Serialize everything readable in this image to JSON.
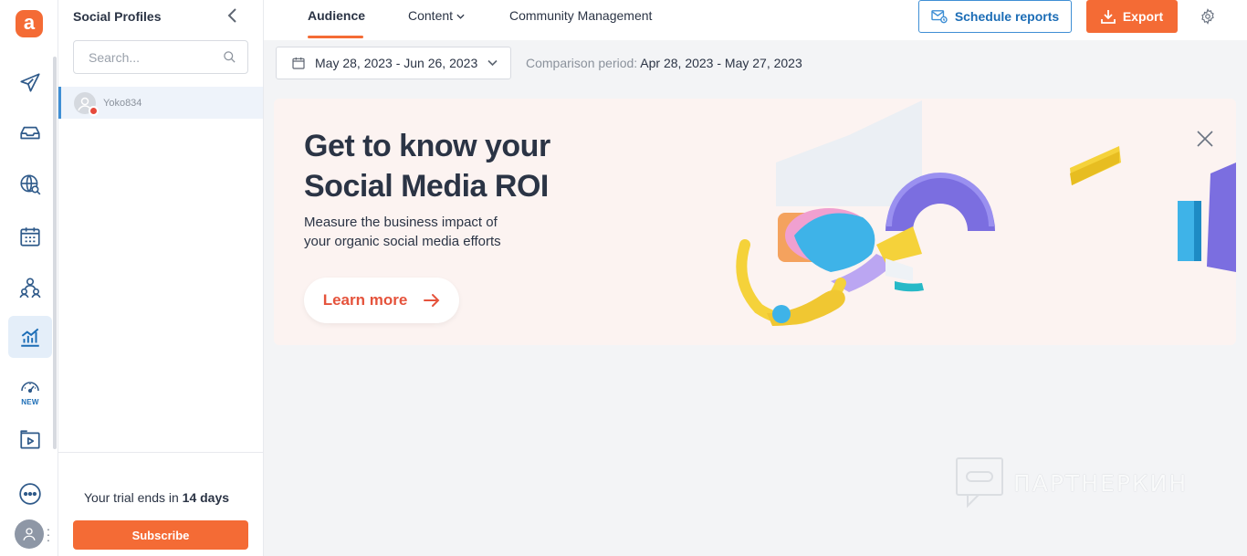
{
  "brand": {
    "logo_letter": "a",
    "accent": "#f46b35",
    "active_blue": "#1c6db6"
  },
  "rail": {
    "items": [
      {
        "name": "publish",
        "icon": "paper-plane-icon"
      },
      {
        "name": "inbox",
        "icon": "inbox-tray-icon"
      },
      {
        "name": "listening",
        "icon": "globe-search-icon"
      },
      {
        "name": "calendar",
        "icon": "calendar-icon"
      },
      {
        "name": "team",
        "icon": "team-icon"
      },
      {
        "name": "analytics",
        "icon": "bar-chart-icon",
        "active": true
      },
      {
        "name": "dashboard",
        "icon": "speedometer-icon",
        "badge": "NEW"
      },
      {
        "name": "media",
        "icon": "media-folder-icon"
      },
      {
        "name": "more",
        "icon": "more-dots-icon"
      }
    ]
  },
  "profiles": {
    "title": "Social Profiles",
    "search_placeholder": "Search...",
    "items": [
      {
        "name": "Yoko834",
        "network_color": "#e64a3c"
      }
    ],
    "trial_prefix": "Your trial ends in ",
    "trial_days": "14 days",
    "subscribe_label": "Subscribe"
  },
  "header": {
    "tabs": [
      {
        "label": "Audience",
        "active": true
      },
      {
        "label": "Content",
        "has_dropdown": true
      },
      {
        "label": "Community Management"
      }
    ],
    "schedule_label": "Schedule reports",
    "export_label": "Export"
  },
  "date_range": {
    "label": "May 28, 2023 - Jun 26, 2023",
    "comparison_prefix": "Comparison period: ",
    "comparison_value": "Apr 28, 2023 - May 27, 2023"
  },
  "banner": {
    "title_line1": "Get to know your",
    "title_line2": "Social Media ROI",
    "sub_line1": "Measure the business impact of",
    "sub_line2": "your organic social media efforts",
    "cta_label": "Learn more",
    "background": "#fcf3f1"
  },
  "watermark": {
    "text": "ПАРТНЕРКИН"
  }
}
